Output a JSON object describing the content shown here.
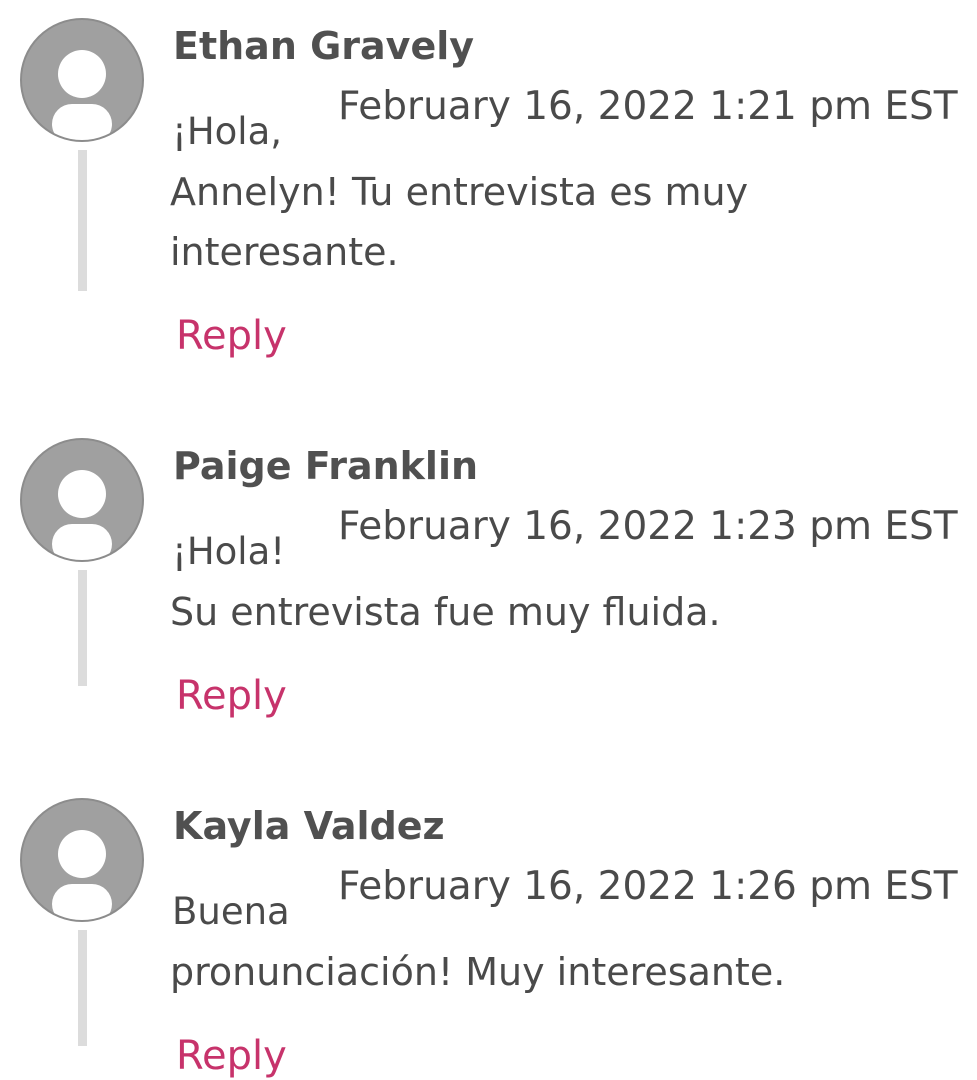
{
  "comments": [
    {
      "author": "Ethan Gravely",
      "date": "February 16, 2022 1:21 pm EST",
      "text_first": "¡Hola,",
      "text_lines": [
        "Annelyn! Tu entrevista es muy",
        "interesante."
      ],
      "reply_label": "Reply"
    },
    {
      "author": "Paige Franklin",
      "date": "February 16, 2022 1:23 pm EST",
      "text_first": "¡Hola!",
      "text_lines": [
        "Su entrevista fue muy fluida."
      ],
      "reply_label": "Reply"
    },
    {
      "author": "Kayla Valdez",
      "date": "February 16, 2022 1:26 pm EST",
      "text_first": "Buena",
      "text_lines": [
        "pronunciación! Muy interesante."
      ],
      "reply_label": "Reply"
    }
  ],
  "icons": {
    "avatar": "default-user-avatar-icon"
  },
  "colors": {
    "reply_link": "#c7336b",
    "avatar_bg": "#a0a0a0",
    "thread_line": "#dcdcdc"
  }
}
